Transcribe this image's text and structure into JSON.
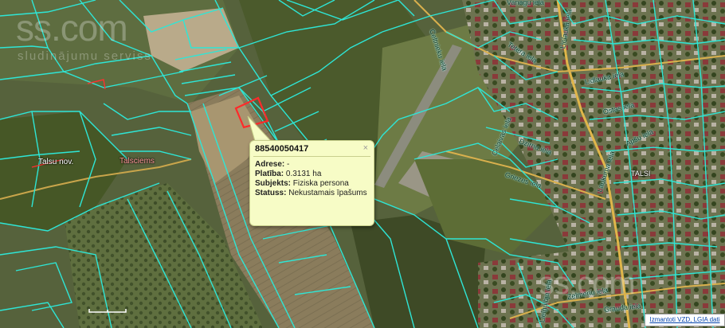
{
  "map": {
    "place_labels": {
      "talsu_nov": "Talsu nov.",
      "talsciems": "Talsciems",
      "talsi": "TALSI"
    },
    "street_labels": {
      "vanagu": "Vanagu iela",
      "celtnieku": "Celtnieku iela",
      "tetera": "Tetera iela",
      "lielaukaa": "Lielaukā iela",
      "lidlauka": "Lidlauka iela",
      "ostas": "Ostas iela",
      "apsu": "Apšu iela",
      "dzirnu": "Dzirnu iela",
      "celaivas": "Celaivas iela",
      "griezes": "Griezes iela",
      "laukuma": "Laukuma iela",
      "zelmenu": "Zelmeņu iela",
      "grauda": "Grauda iela",
      "lielgulbja": "Lielgulbja iela"
    },
    "watermark": {
      "brand": "ss.com",
      "tagline": "sludinājumu serviss"
    },
    "colors": {
      "parcel_border": "#2ee6d6",
      "selected_parcel": "#ff2a2a",
      "road": "#e0b64a",
      "popup_bg": "#f7fcc6"
    }
  },
  "popup": {
    "title": "88540050417",
    "close_icon": "×",
    "address_label": "Adrese:",
    "address_value": "-",
    "area_label": "Platība:",
    "area_value": "0.3131 ha",
    "subject_label": "Subjekts:",
    "subject_value": "Fiziska persona",
    "status_label": "Statuss:",
    "status_value": "Nekustamais īpašums"
  },
  "credit": {
    "text": "Izmantoti VZD, LGIA dati"
  }
}
